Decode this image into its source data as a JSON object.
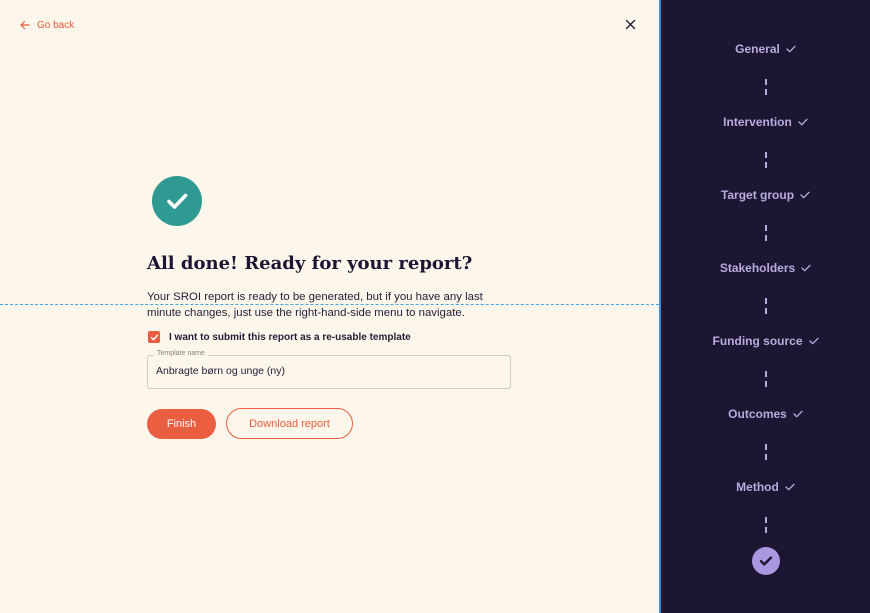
{
  "header": {
    "back_label": "Go back"
  },
  "main": {
    "title": "All done! Ready for your report?",
    "description": "Your SROI report is ready to be generated, but if you have any last minute changes, just use the right-hand-side menu to navigate.",
    "checkbox_label": "I want to submit this report as a re-usable template",
    "checkbox_checked": true,
    "template_field": {
      "label": "Template name",
      "value": "Anbragte børn og unge (ny)"
    },
    "finish_label": "Finish",
    "download_label": "Download report"
  },
  "sidebar": {
    "steps": [
      {
        "label": "General",
        "completed": true
      },
      {
        "label": "Intervention",
        "completed": true
      },
      {
        "label": "Target group",
        "completed": true
      },
      {
        "label": "Stakeholders",
        "completed": true
      },
      {
        "label": "Funding source",
        "completed": true
      },
      {
        "label": "Outcomes",
        "completed": true
      },
      {
        "label": "Method",
        "completed": true
      }
    ]
  },
  "colors": {
    "accent": "#ea5e40",
    "success": "#2f9a92",
    "sidebar_bg": "#1c1633",
    "sidebar_text": "#b8acdc",
    "page_bg": "#fdf6ea"
  }
}
